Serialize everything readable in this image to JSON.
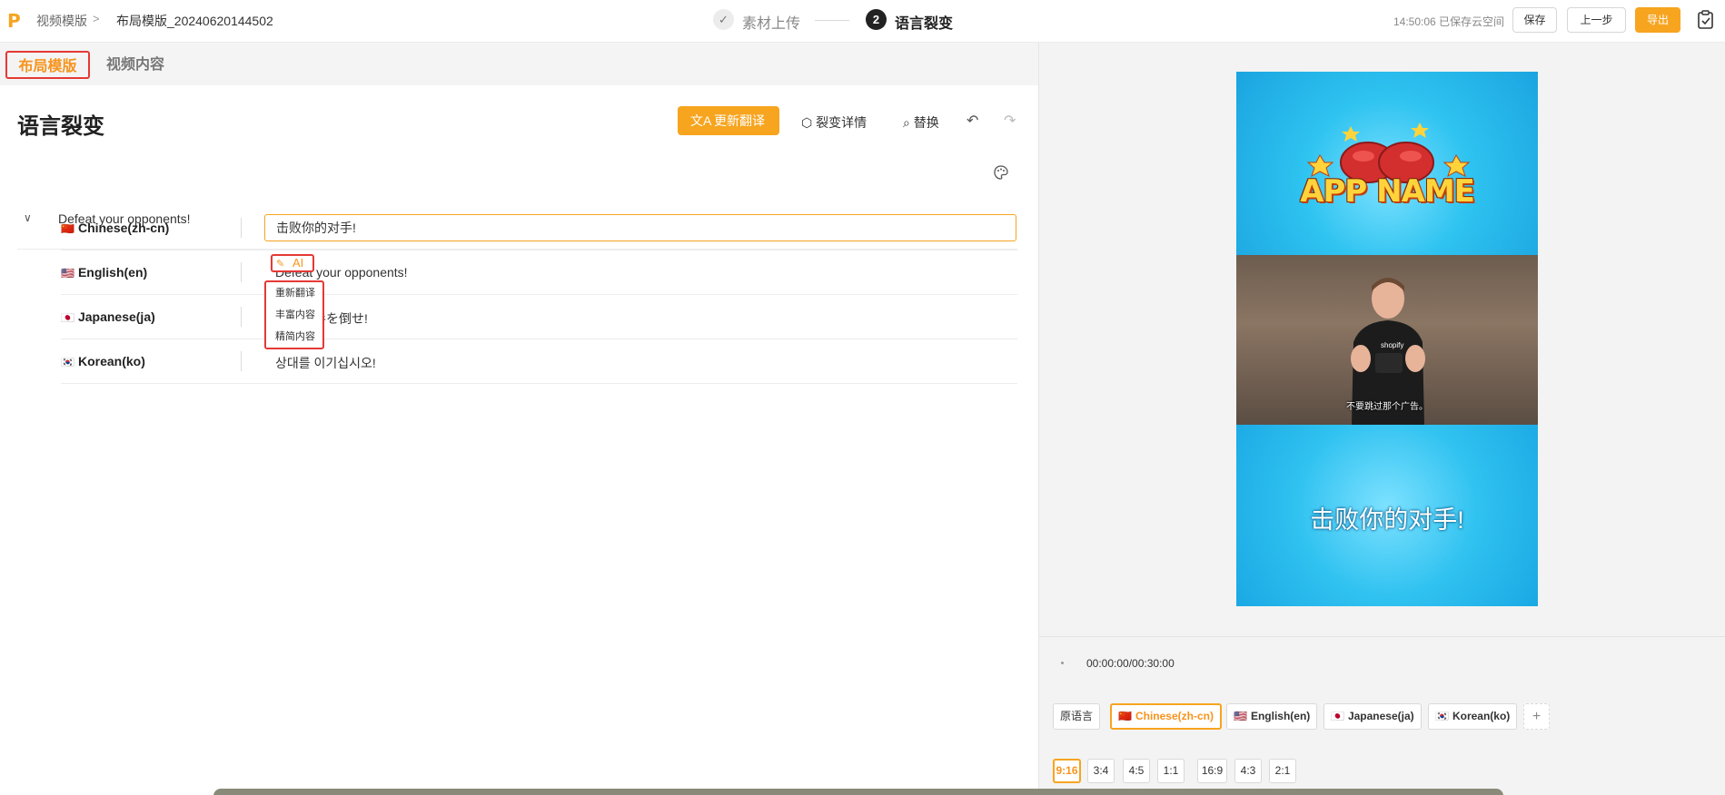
{
  "header": {
    "breadcrumb_root": "视频模版",
    "breadcrumb_sep": ">",
    "breadcrumb_current": "布局模版_20240620144502",
    "steps": [
      {
        "index": "✓",
        "label": "素材上传"
      },
      {
        "index": "2",
        "label": "语言裂变"
      }
    ],
    "save_status": "14:50:06 已保存云空间",
    "save_label": "保存",
    "prev_label": "上一步",
    "export_label": "导出"
  },
  "tabs": {
    "layout": "布局模版",
    "video": "视频内容"
  },
  "toolbar": {
    "title": "语言裂变",
    "update_label": "更新翻译",
    "detail_label": "裂变详情",
    "replace_label": "替换"
  },
  "group": {
    "title": "Defeat your opponents!",
    "rows": [
      {
        "flag": "🇨🇳",
        "label": "Chinese(zh-cn)",
        "text": "击败你的对手!"
      },
      {
        "flag": "🇺🇸",
        "label": "English(en)",
        "text": "Defeat your opponents!"
      },
      {
        "flag": "🇯🇵",
        "label": "Japanese(ja)",
        "text": "対戦相手を倒せ!"
      },
      {
        "flag": "🇰🇷",
        "label": "Korean(ko)",
        "text": "상대를 이기십시오!"
      }
    ]
  },
  "ai_menu": {
    "button_label": "AI",
    "items": [
      "重新翻译",
      "丰富内容",
      "精简内容"
    ]
  },
  "preview": {
    "app_name": "APP NAME",
    "subtitle": "不要跳过那个广告。",
    "caption": "击败你的对手!",
    "time": "00:00:00/00:30:00"
  },
  "languages": {
    "original": "原语言",
    "chips": [
      {
        "flag": "🇨🇳",
        "label": "Chinese(zh-cn)"
      },
      {
        "flag": "🇺🇸",
        "label": "English(en)"
      },
      {
        "flag": "🇯🇵",
        "label": "Japanese(ja)"
      },
      {
        "flag": "🇰🇷",
        "label": "Korean(ko)"
      }
    ],
    "add": "+"
  },
  "ratios": [
    "9:16",
    "3:4",
    "4:5",
    "1:1",
    "16:9",
    "4:3",
    "2:1"
  ],
  "colors": {
    "accent": "#f7a41f",
    "highlight_box": "#e53935"
  }
}
